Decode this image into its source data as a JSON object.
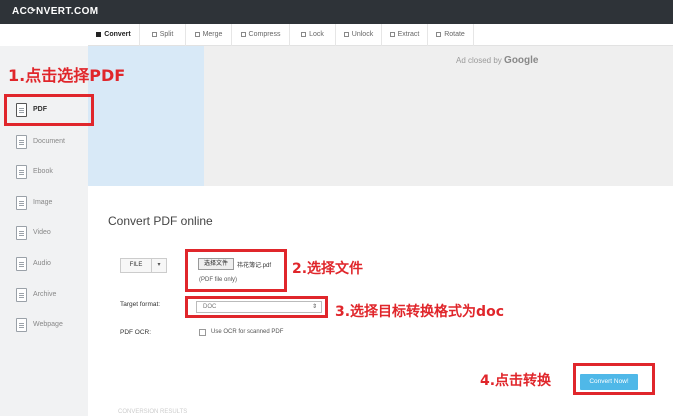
{
  "app": {
    "logo": "AC⟳NVERT.COM"
  },
  "tabs": [
    {
      "label": "Convert",
      "active": true
    },
    {
      "label": "Split",
      "active": false
    },
    {
      "label": "Merge",
      "active": false
    },
    {
      "label": "Compress",
      "active": false
    },
    {
      "label": "Lock",
      "active": false
    },
    {
      "label": "Unlock",
      "active": false
    },
    {
      "label": "Extract",
      "active": false
    },
    {
      "label": "Rotate",
      "active": false
    }
  ],
  "sidebar": {
    "items": [
      {
        "label": "PDF",
        "icon": "pdf-file-icon",
        "active": true
      },
      {
        "label": "Document",
        "icon": "document-icon",
        "active": false
      },
      {
        "label": "Ebook",
        "icon": "ebook-icon",
        "active": false
      },
      {
        "label": "Image",
        "icon": "image-icon",
        "active": false
      },
      {
        "label": "Video",
        "icon": "video-icon",
        "active": false
      },
      {
        "label": "Audio",
        "icon": "audio-icon",
        "active": false
      },
      {
        "label": "Archive",
        "icon": "archive-icon",
        "active": false
      },
      {
        "label": "Webpage",
        "icon": "webpage-icon",
        "active": false
      }
    ]
  },
  "ad": {
    "prefix": "Ad closed by",
    "brand": "Google"
  },
  "main": {
    "title": "Convert PDF online",
    "file_button": "FILE",
    "file_caret": "▾",
    "choose_button": "选择文件",
    "file_name": "祎花簿记.pdf",
    "file_hint": "(PDF file only)",
    "target_label": "Target format:",
    "target_value": "DOC",
    "target_arrow": "⇕",
    "ocr_label": "PDF OCR:",
    "ocr_option": "Use OCR for scanned PDF",
    "convert_button": "Convert Now!",
    "bottom_text": "CONVERSION RESULTS"
  },
  "annotations": {
    "step1": "1.点击选择PDF",
    "step2": "2.选择文件",
    "step3": "3.选择目标转换格式为doc",
    "step4": "4.点击转换"
  },
  "colors": {
    "topbar": "#2e3338",
    "highlight": "#e0262b",
    "convert_button": "#4fb8e8",
    "ad_blue": "#d8e9f7"
  }
}
